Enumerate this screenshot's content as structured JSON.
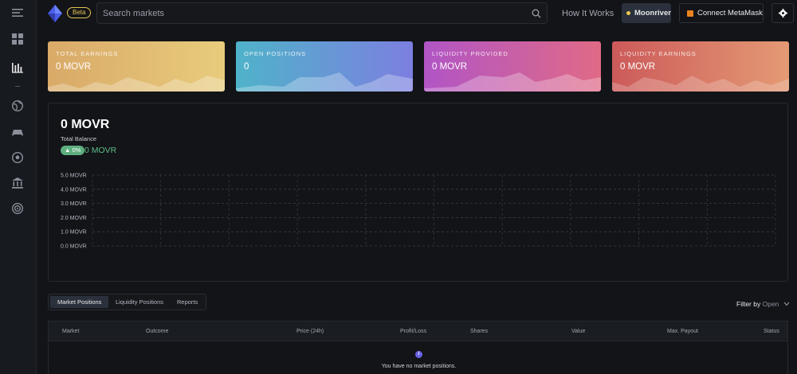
{
  "header": {
    "beta_label": "Beta",
    "search_placeholder": "Search markets",
    "how_it_works": "How It Works",
    "network_label": "Moonriver",
    "connect_label": "Connect MetaMask"
  },
  "sidebar": {
    "icons": [
      "menu-icon",
      "dashboard-icon",
      "portfolio-chart-icon",
      "globe-icon",
      "gamepad-icon",
      "soccer-ball-icon",
      "bank-icon",
      "target-icon"
    ]
  },
  "cards": [
    {
      "label": "TOTAL EARNINGS",
      "value": "0 MOVR"
    },
    {
      "label": "OPEN POSITIONS",
      "value": "0"
    },
    {
      "label": "LIQUIDITY PROVIDED",
      "value": "0 MOVR"
    },
    {
      "label": "LIQUIDITY EARNINGS",
      "value": "0 MOVR"
    }
  ],
  "balance": {
    "value": "0 MOVR",
    "label": "Total Balance",
    "change_pct": "▲ 0%",
    "change_value": "0 MOVR"
  },
  "chart_data": {
    "type": "line",
    "y_ticks": [
      "5.0 MOVR",
      "4.0 MOVR",
      "3.0 MOVR",
      "2.0 MOVR",
      "1.0 MOVR",
      "0.0 MOVR"
    ],
    "ylim": [
      0,
      5
    ],
    "grid": true,
    "series": []
  },
  "tabs": [
    {
      "label": "Market Positions",
      "active": true
    },
    {
      "label": "Liquidity Positions",
      "active": false
    },
    {
      "label": "Reports",
      "active": false
    }
  ],
  "filter": {
    "label": "Filter by",
    "value": "Open"
  },
  "table": {
    "headers": [
      "Market",
      "Outcome",
      "Price (24h)",
      "Profit/Loss",
      "Shares",
      "Value",
      "Max. Payout",
      "Status"
    ],
    "empty_message": "You have no market positions."
  },
  "colors": {
    "accent": "#6a63e6",
    "positive": "#5fbf88",
    "beta": "#e6c452"
  }
}
